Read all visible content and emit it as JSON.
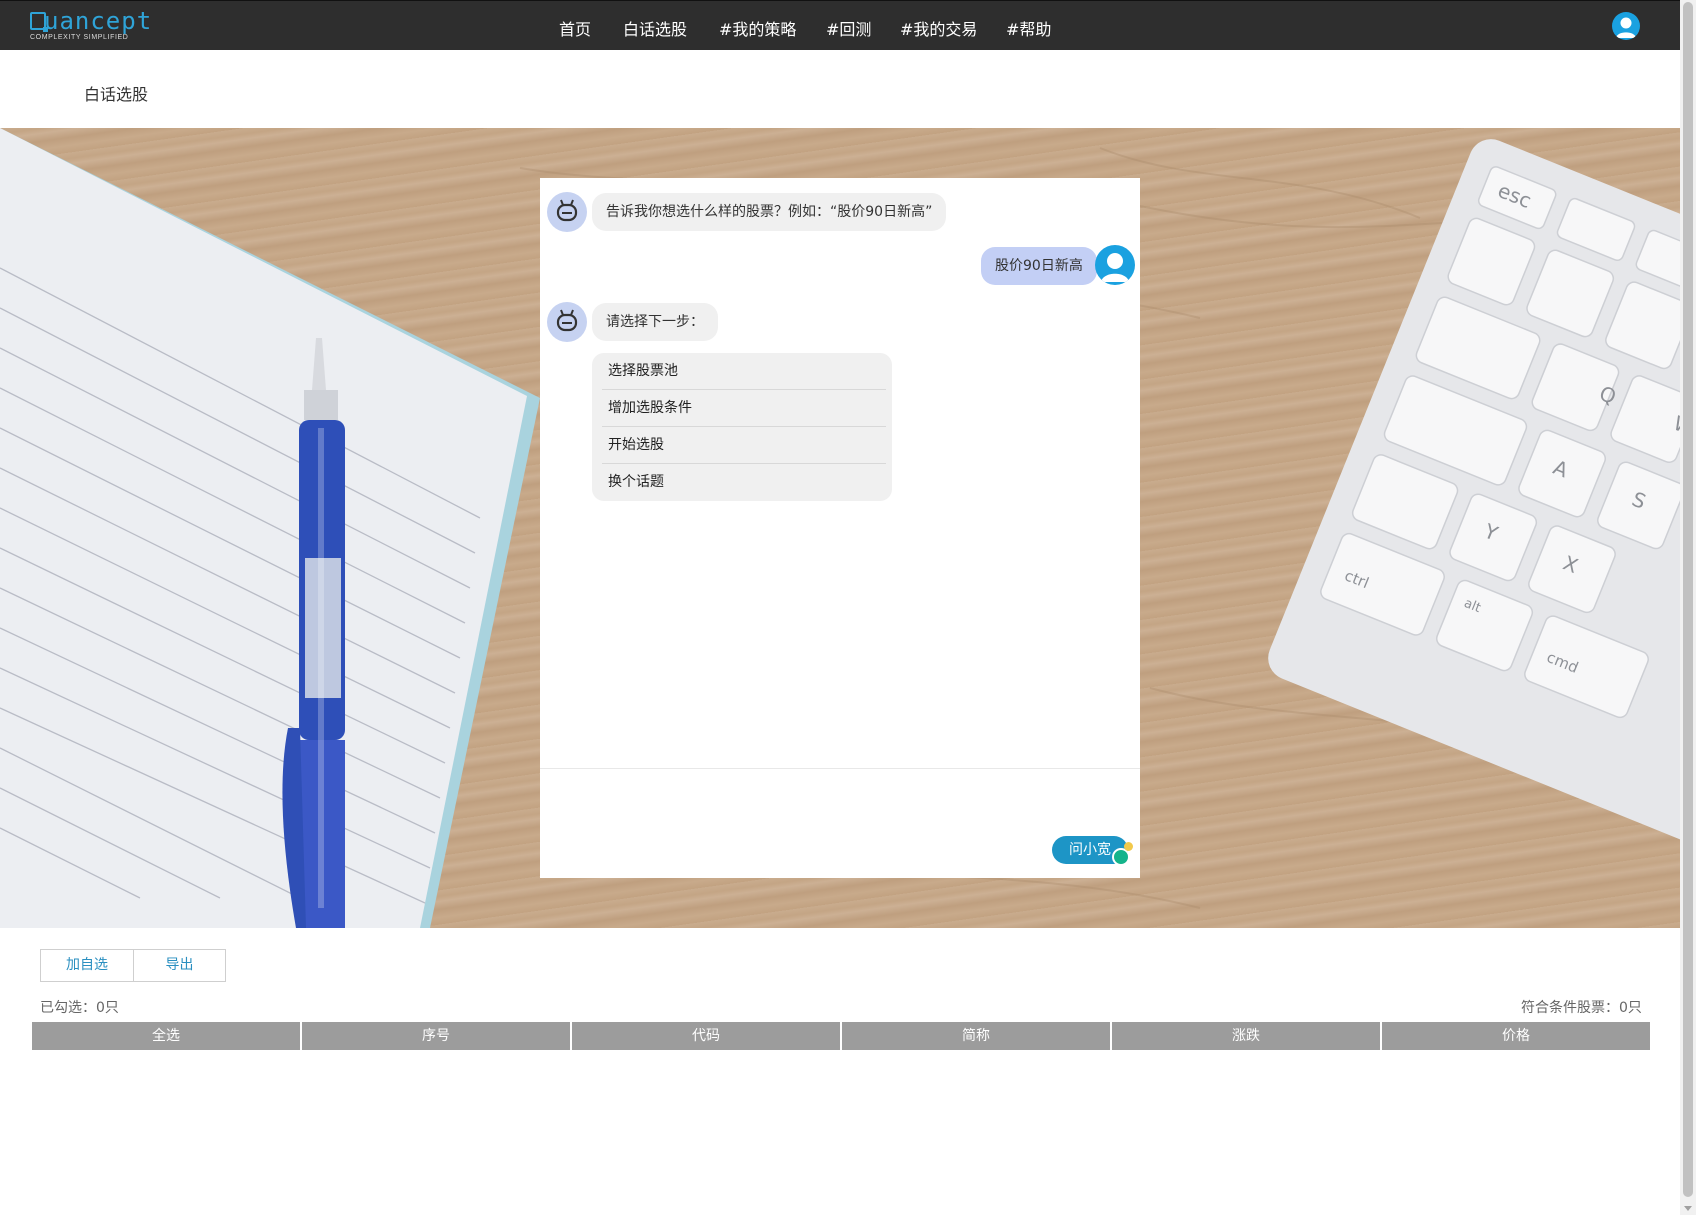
{
  "navbar": {
    "logo_word": "uancept",
    "logo_tagline": "COMPLEXITY SIMPLIFIED",
    "items": [
      {
        "label": "首页"
      },
      {
        "label": "白话选股"
      },
      {
        "label": "#我的策略"
      },
      {
        "label": "#回测"
      },
      {
        "label": "#我的交易"
      },
      {
        "label": "#帮助"
      }
    ],
    "avatar_icon": "user-avatar-icon"
  },
  "page": {
    "title": "白话选股"
  },
  "chat": {
    "messages": [
      {
        "from": "bot",
        "text": "告诉我你想选什么样的股票？例如：“股价90日新高”"
      },
      {
        "from": "user",
        "text": "股价90日新高"
      },
      {
        "from": "bot",
        "text": "请选择下一步："
      }
    ],
    "options": [
      {
        "label": "选择股票池"
      },
      {
        "label": "增加选股条件"
      },
      {
        "label": "开始选股"
      },
      {
        "label": "换个话题"
      }
    ],
    "ask_button_label": "问小宽",
    "bot_icon": "robot-icon"
  },
  "results": {
    "buttons": [
      {
        "label": "加自选"
      },
      {
        "label": "导出"
      }
    ],
    "selected_text": "已勾选：0只",
    "match_text": "符合条件股票：0只",
    "columns": [
      "全选",
      "序号",
      "代码",
      "简称",
      "涨跌",
      "价格"
    ]
  },
  "colors": {
    "navbar_bg": "#2e2e2e",
    "accent": "#1d95c6",
    "logo": "#2fa4d8",
    "user_bubble": "#c3cff5",
    "bot_bubble": "#f0f0f0",
    "table_header": "#9c9c9c"
  }
}
